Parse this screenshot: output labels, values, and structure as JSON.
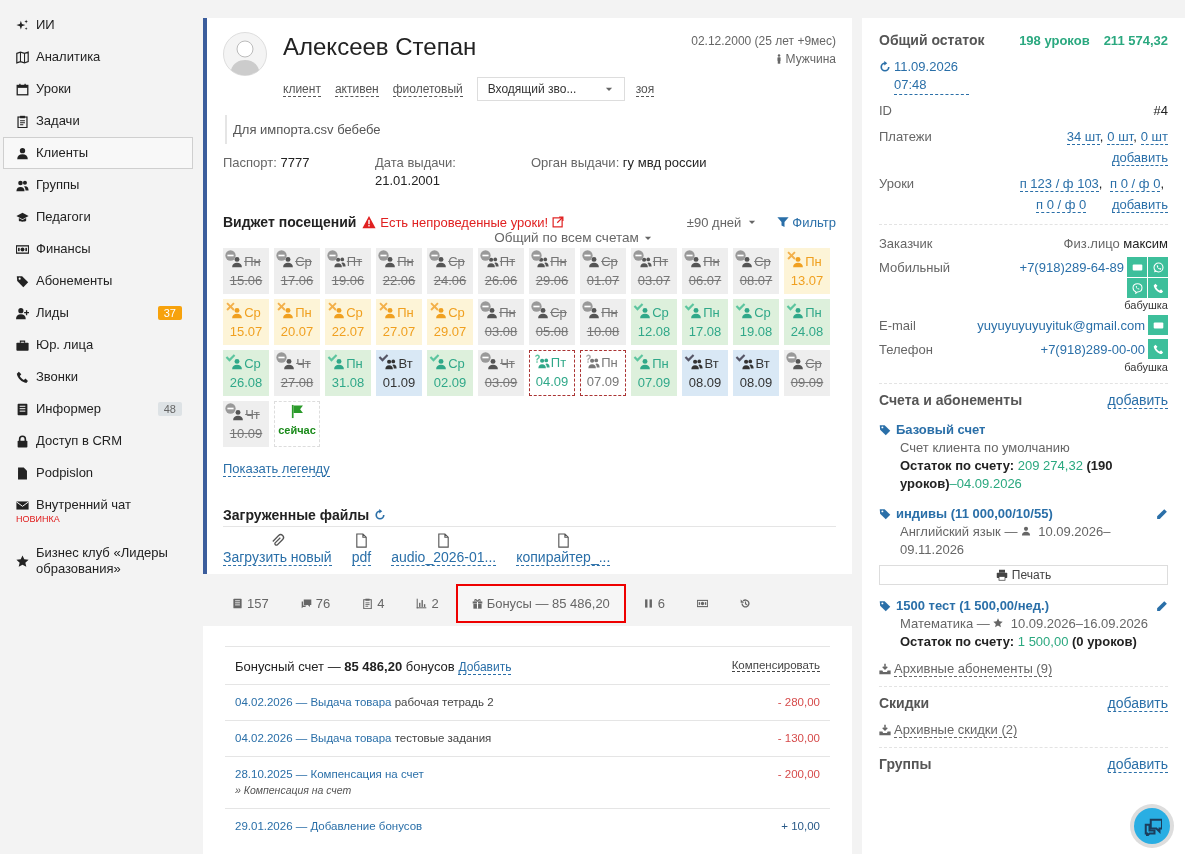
{
  "sidebar": {
    "items": [
      {
        "label": "ИИ",
        "selected": false
      },
      {
        "label": "Аналитика",
        "selected": false
      },
      {
        "label": "Уроки",
        "selected": false
      },
      {
        "label": "Задачи",
        "selected": false
      },
      {
        "label": "Клиенты",
        "selected": true
      },
      {
        "label": "Группы",
        "selected": false
      },
      {
        "label": "Педагоги",
        "selected": false
      },
      {
        "label": "Финансы",
        "selected": false
      },
      {
        "label": "Абонементы",
        "selected": false
      },
      {
        "label": "Лиды",
        "selected": false,
        "badge": {
          "text": "37",
          "color": "#f7a20c"
        }
      },
      {
        "label": "Юр. лица",
        "selected": false
      },
      {
        "label": "Звонки",
        "selected": false
      },
      {
        "label": "Информер",
        "selected": false,
        "badge": {
          "text": "48",
          "color": "#dde2e5"
        }
      },
      {
        "label": "Доступ в CRM",
        "selected": false
      },
      {
        "label": "Podpislon",
        "selected": false
      },
      {
        "label": "Внутренний чат",
        "selected": false,
        "note": "НОВИНКА"
      },
      {
        "label": "Бизнес клуб «Лидеры образования»",
        "selected": false
      }
    ]
  },
  "client": {
    "name": "Алексеев Степан",
    "birth": "02.12.2000 (25 лет +9мес)",
    "gender": "Мужчина",
    "tags": [
      "клиент",
      "активен",
      "фиолетовый"
    ],
    "call_select": "Входящий зво...",
    "manager": "зоя",
    "comment": "Для импорта.csv бебебе",
    "passport": {
      "label": "Паспорт:",
      "value": "7777"
    },
    "issue_date": {
      "label": "Дата выдачи:",
      "value": "21.01.2001"
    },
    "issuer": {
      "label": "Орган выдачи:",
      "value": "гу мвд россии"
    }
  },
  "visits": {
    "title": "Виджет посещений",
    "warning": "Есть непроведенные уроки!",
    "range": "±90 дней",
    "filter": "Фильтр",
    "account": "Общий по всем счетам",
    "legend": "Показать легенду",
    "cells": [
      {
        "day": "Пн",
        "date": "15.06",
        "kind": "cancelled",
        "group": false
      },
      {
        "day": "Ср",
        "date": "17.06",
        "kind": "cancelled",
        "group": false
      },
      {
        "day": "Пт",
        "date": "19.06",
        "kind": "cancelled",
        "group": true
      },
      {
        "day": "Пн",
        "date": "22.06",
        "kind": "cancelled",
        "group": false
      },
      {
        "day": "Ср",
        "date": "24.06",
        "kind": "cancelled",
        "group": false
      },
      {
        "day": "Пт",
        "date": "26.06",
        "kind": "cancelled",
        "group": true
      },
      {
        "day": "Пн",
        "date": "29.06",
        "kind": "cancelled",
        "group": true
      },
      {
        "day": "Ср",
        "date": "01.07",
        "kind": "cancelled",
        "group": false
      },
      {
        "day": "Пт",
        "date": "03.07",
        "kind": "cancelled",
        "group": true
      },
      {
        "day": "Пн",
        "date": "06.07",
        "kind": "cancelled",
        "group": false
      },
      {
        "day": "Ср",
        "date": "08.07",
        "kind": "cancelled",
        "group": false
      },
      {
        "day": "Пн",
        "date": "13.07",
        "kind": "missed",
        "group": false
      },
      {
        "day": "Ср",
        "date": "15.07",
        "kind": "missed",
        "group": false
      },
      {
        "day": "Пн",
        "date": "20.07",
        "kind": "missed",
        "group": false
      },
      {
        "day": "Ср",
        "date": "22.07",
        "kind": "missed",
        "group": false
      },
      {
        "day": "Пн",
        "date": "27.07",
        "kind": "missed",
        "group": false
      },
      {
        "day": "Ср",
        "date": "29.07",
        "kind": "missed",
        "group": false
      },
      {
        "day": "Пн",
        "date": "03.08",
        "kind": "cancelled",
        "group": false
      },
      {
        "day": "Ср",
        "date": "05.08",
        "kind": "cancelled",
        "group": false
      },
      {
        "day": "Пн",
        "date": "10.08",
        "kind": "cancelled",
        "group": false
      },
      {
        "day": "Ср",
        "date": "12.08",
        "kind": "attended",
        "group": false
      },
      {
        "day": "Пн",
        "date": "17.08",
        "kind": "attended",
        "group": false
      },
      {
        "day": "Ср",
        "date": "19.08",
        "kind": "attended",
        "group": false
      },
      {
        "day": "Пн",
        "date": "24.08",
        "kind": "attended",
        "group": false
      },
      {
        "day": "Ср",
        "date": "26.08",
        "kind": "attended",
        "group": false
      },
      {
        "day": "Чт",
        "date": "27.08",
        "kind": "cancelled",
        "group": false
      },
      {
        "day": "Пн",
        "date": "31.08",
        "kind": "attended",
        "group": false
      },
      {
        "day": "Вт",
        "date": "01.09",
        "kind": "planned",
        "group": true
      },
      {
        "day": "Ср",
        "date": "02.09",
        "kind": "attended",
        "group": false
      },
      {
        "day": "Чт",
        "date": "03.09",
        "kind": "cancelled",
        "group": false
      },
      {
        "day": "Пт",
        "date": "04.09",
        "kind": "pending_attended",
        "group": true
      },
      {
        "day": "Пн",
        "date": "07.09",
        "kind": "pending",
        "group": true
      },
      {
        "day": "Пн",
        "date": "07.09",
        "kind": "attended",
        "group": false
      },
      {
        "day": "Вт",
        "date": "08.09",
        "kind": "planned",
        "group": true
      },
      {
        "day": "Вт",
        "date": "08.09",
        "kind": "planned",
        "group": true
      },
      {
        "day": "Ср",
        "date": "09.09",
        "kind": "cancelled",
        "group": false
      },
      {
        "day": "Чт",
        "date": "10.09",
        "kind": "cancelled",
        "group": false
      },
      {
        "label": "сейчас",
        "kind": "now"
      }
    ]
  },
  "files": {
    "title": "Загруженные файлы",
    "items": [
      {
        "kind": "upload",
        "label": "Загрузить новый"
      },
      {
        "kind": "file",
        "label": "pdf"
      },
      {
        "kind": "file",
        "label": "audio_2026-01..."
      },
      {
        "kind": "file",
        "label": "копирайтер_..."
      }
    ]
  },
  "tabs": [
    {
      "label": "157",
      "selected": false
    },
    {
      "label": "76",
      "selected": false
    },
    {
      "label": "4",
      "selected": false
    },
    {
      "label": "2",
      "selected": false
    },
    {
      "label": "Бонусы — 85 486,20",
      "selected": true
    },
    {
      "label": "6",
      "selected": false
    },
    {
      "selected": false
    },
    {
      "selected": false
    }
  ],
  "bonus": {
    "title": "Бонусный счет — **85 486,20** бонусов",
    "add": "Добавить",
    "compensate": "Компенсировать",
    "rows": [
      {
        "link": "04.02.2026 — Выдача товара",
        "desc": "рабочая тетрадь 2",
        "amount": "- 280,00",
        "kind": "debit"
      },
      {
        "link": "04.02.2026 — Выдача товара",
        "desc": "тестовые задания",
        "amount": "- 130,00",
        "kind": "debit"
      },
      {
        "link": "28.10.2025 — Компенсация на счет",
        "note": "» Компенсация на счет",
        "amount": "- 200,00",
        "kind": "debit"
      },
      {
        "link": "29.01.2026 — Добавление бонусов",
        "amount": "+ 10,00",
        "kind": "credit"
      }
    ]
  },
  "summary": {
    "title": "Общий остаток",
    "lessons": "198 уроков",
    "amount": "211 574,32",
    "updated": "11.09.2026 07:48",
    "id_label": "ID",
    "id": "#4",
    "payments": {
      "label": "Платежи",
      "links": [
        {
          "text": "34 шт",
          "sep": ","
        },
        {
          "text": "0 шт",
          "sep": ","
        },
        {
          "text": "0 шт"
        }
      ],
      "add": "добавить"
    },
    "lessons_row": {
      "label": "Уроки",
      "links": [
        {
          "text": "п 123 / ф 103",
          "sep": ","
        },
        {
          "text": "п 0 / ф 0",
          "sep": ","
        },
        {
          "text": "п 0 / ф 0"
        }
      ],
      "add": "добавить"
    }
  },
  "contacts": {
    "customer": {
      "label": "Заказчик",
      "kind": "Физ.лицо",
      "name": "максим"
    },
    "rows": [
      {
        "label": "Мобильный",
        "value": "+7(918)289-64-89",
        "kind": "mobile",
        "note": "бабушка"
      },
      {
        "label": "E-mail",
        "value": "yuyuyuyuyuyituk@gmail.com",
        "kind": "email"
      },
      {
        "label": "Телефон",
        "value": "+7(918)289-00-00",
        "kind": "phone",
        "note": "бабушка"
      }
    ]
  },
  "accounts": {
    "title": "Счета и абонементы",
    "add": "добавить",
    "items": [
      {
        "kind": "account",
        "name": "Базовый счет",
        "desc": "Счет клиента по умолчанию",
        "balance_label": "Остаток по счету:",
        "balance": "209 274,32",
        "lessons": "(190 уроков)",
        "until": "–04.09.2026"
      },
      {
        "kind": "subscription",
        "name": "индивы (11 000,00/10/55)",
        "subject": "Английский язык —",
        "group": false,
        "dates": "10.09.2026–09.11.2026",
        "print": "Печать"
      },
      {
        "kind": "subscription",
        "name": "1500 тест (1 500,00/нед.)",
        "subject": "Математика —",
        "group": true,
        "dates": "10.09.2026–16.09.2026",
        "balance_label": "Остаток по счету:",
        "balance": "1 500,00",
        "lessons": "(0 уроков)"
      }
    ],
    "archive": "Архивные абонементы (9)"
  },
  "discounts": {
    "title": "Скидки",
    "add": "добавить",
    "archive": "Архивные скидки (2)"
  },
  "groups": {
    "title": "Группы",
    "add": "добавить"
  }
}
